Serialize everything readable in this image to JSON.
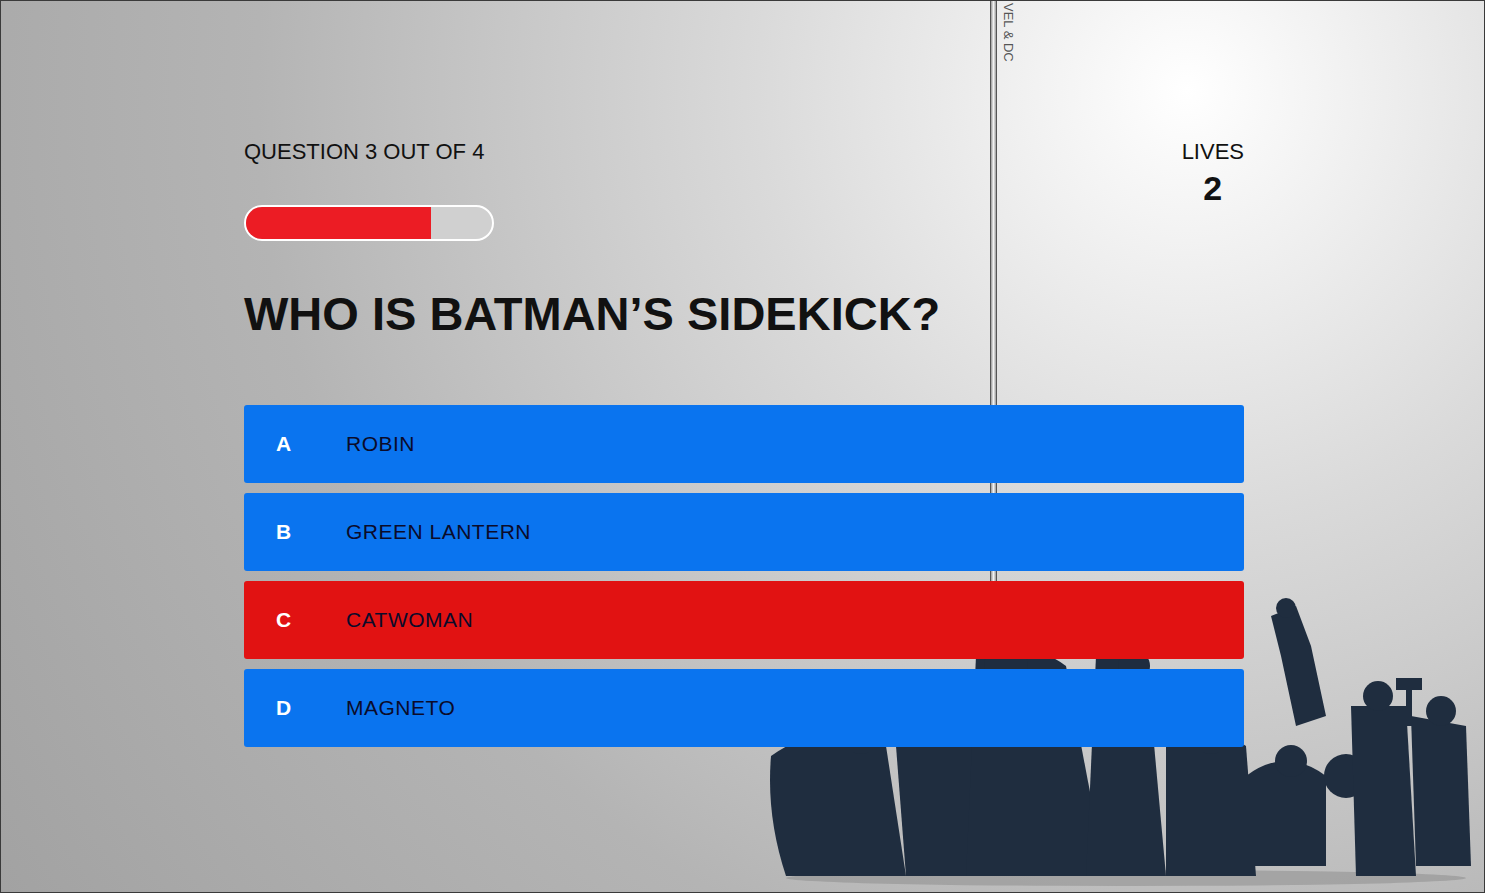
{
  "header": {
    "progress_label": "QUESTION 3 OUT OF 4",
    "progress": {
      "level": 0.75
    },
    "lives_label": "LIVES",
    "lives": "2"
  },
  "banner": "VEL & DC",
  "question": "WHO IS BATMAN’S SIDEKICK?",
  "options": [
    {
      "letter": "A",
      "text": "ROBIN",
      "selected": false
    },
    {
      "letter": "B",
      "text": "GREEN LANTERN",
      "selected": false
    },
    {
      "letter": "C",
      "text": "CATWOMAN",
      "selected": true
    },
    {
      "letter": "D",
      "text": "MAGNETO",
      "selected": false
    }
  ]
}
